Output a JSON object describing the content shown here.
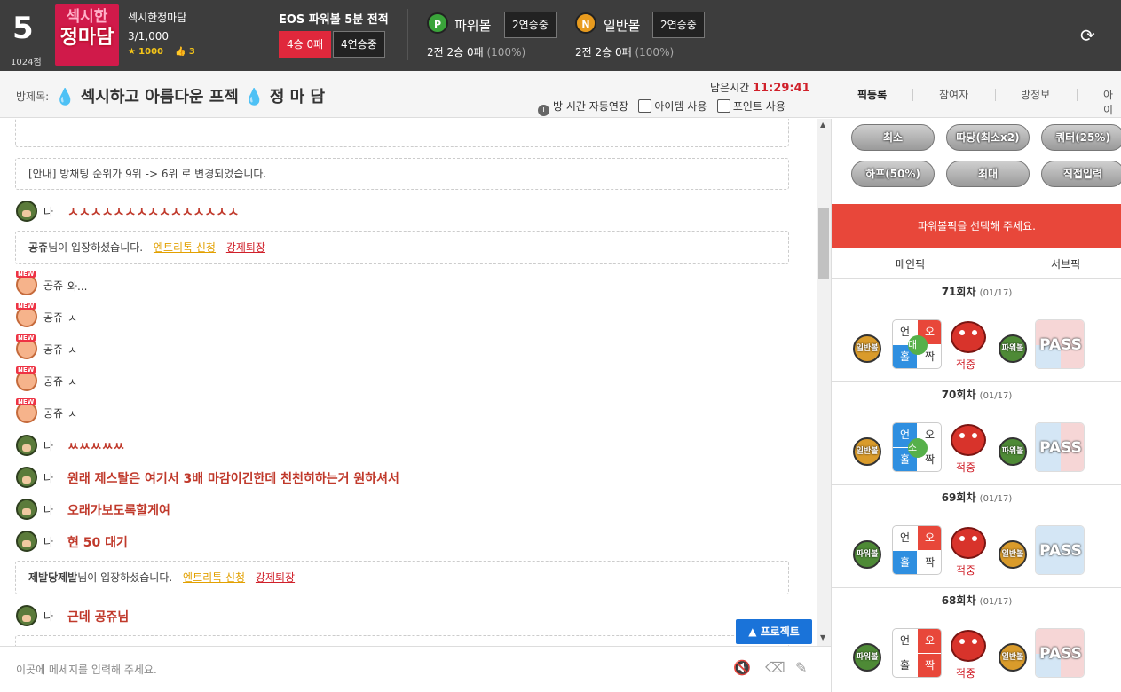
{
  "top": {
    "rank": "5",
    "rank_points": "1024점",
    "logo_line1": "섹시한",
    "logo_line2": "정마담",
    "room_name": "섹시한정마담",
    "room_count": "3/1,000",
    "star_count": "1000",
    "like_count": "3",
    "eos_title": "EOS 파워볼 5분 전적",
    "record": "4승 0패",
    "streak": "4연승중",
    "powerball_icon": "P",
    "powerball_label": "파워볼",
    "powerball_streak": "2연승중",
    "powerball_stat": "2전 2승 0패",
    "powerball_pct": "(100%)",
    "normal_icon": "N",
    "normal_label": "일반볼",
    "normal_streak": "2연승중",
    "normal_stat": "2전 2승 0패",
    "normal_pct": "(100%)"
  },
  "room": {
    "title_label": "방제목:",
    "title": "섹시하고 아름다운 프젝",
    "title2": "정 마 담",
    "remain_label": "남은시간",
    "remain_time": "11:29:41",
    "auto_extend": "방 시간 자동연장",
    "item_use": "아이템 사용",
    "point_use": "포인트 사용"
  },
  "tabs": [
    "픽등록",
    "참여자",
    "방정보",
    "아이"
  ],
  "chat": {
    "notice1": "[안내] 방채팅 순위가 9위 -> 6위 로 변경되었습니다.",
    "join1_name": "공쥬",
    "join_suffix": "님이 입장하셨습니다.",
    "entry_request": "엔트리톡 신청",
    "force_exit": "강제퇴장",
    "join2_name": "제발당제발",
    "messages": [
      {
        "nick": "나",
        "text": "ㅅㅅㅅㅅㅅㅅㅅㅅㅅㅅㅅㅅㅅㅅㅅ",
        "me": true
      },
      {
        "nick": "공쥬",
        "text": "와...",
        "me": false
      },
      {
        "nick": "공쥬",
        "text": "ㅅ",
        "me": false
      },
      {
        "nick": "공쥬",
        "text": "ㅅ",
        "me": false
      },
      {
        "nick": "공쥬",
        "text": "ㅅ",
        "me": false
      },
      {
        "nick": "공쥬",
        "text": "ㅅ",
        "me": false
      },
      {
        "nick": "나",
        "text": "ㅆㅆㅆㅆㅆ",
        "me": true
      },
      {
        "nick": "나",
        "text": "원래 제스탈은 여기서 3배 마감이긴한데 천천히하는거 원하셔서",
        "me": true
      },
      {
        "nick": "나",
        "text": "오래가보도록할게여",
        "me": true
      },
      {
        "nick": "나",
        "text": "현 50 대기",
        "me": true
      },
      {
        "nick": "나",
        "text": "근데 공쥬님",
        "me": true
      }
    ],
    "new_badge": "NEW",
    "project_button": "▲ 프로젝트",
    "input_placeholder": "이곳에 메세지를 입력해 주세요."
  },
  "side": {
    "buttons": [
      "최소",
      "따당(최소x2)",
      "쿼터(25%)",
      "하프(50%)",
      "최대",
      "직접입력"
    ],
    "prompt": "파워볼픽을 선택해 주세요.",
    "main_pick": "메인픽",
    "sub_pick": "서브픽",
    "hit_label": "적중",
    "pass_label": "PASS",
    "grid_labels": [
      "언",
      "오",
      "홀",
      "짝"
    ],
    "rounds": [
      {
        "title": "71회차",
        "date": "(01/17)",
        "left": "일반볼",
        "right": "파워볼",
        "mid": "대"
      },
      {
        "title": "70회차",
        "date": "(01/17)",
        "left": "일반볼",
        "right": "파워볼",
        "mid": "소"
      },
      {
        "title": "69회차",
        "date": "(01/17)",
        "left": "파워볼",
        "right": "일반볼",
        "mid": ""
      },
      {
        "title": "68회차",
        "date": "(01/17)",
        "left": "파워볼",
        "right": "일반볼",
        "mid": ""
      }
    ]
  }
}
